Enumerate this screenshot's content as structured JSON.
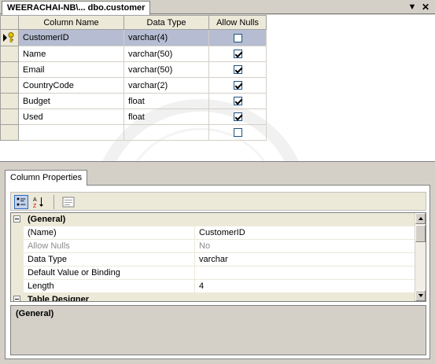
{
  "window": {
    "tab_title": "WEERACHAI-NB\\... dbo.customer",
    "dropdown_glyph": "▼",
    "close_glyph": "✕"
  },
  "table_designer": {
    "headers": {
      "name": "Column Name",
      "type": "Data Type",
      "nulls": "Allow Nulls"
    },
    "rows": [
      {
        "name": "CustomerID",
        "type": "varchar(4)",
        "allow_nulls": false,
        "primary_key": true,
        "selected": true
      },
      {
        "name": "Name",
        "type": "varchar(50)",
        "allow_nulls": true
      },
      {
        "name": "Email",
        "type": "varchar(50)",
        "allow_nulls": true
      },
      {
        "name": "CountryCode",
        "type": "varchar(2)",
        "allow_nulls": true
      },
      {
        "name": "Budget",
        "type": "float",
        "allow_nulls": true
      },
      {
        "name": "Used",
        "type": "float",
        "allow_nulls": true
      },
      {
        "name": "",
        "type": "",
        "allow_nulls": false
      }
    ]
  },
  "column_properties": {
    "tab_label": "Column Properties",
    "rows": [
      {
        "kind": "category",
        "name": "(General)"
      },
      {
        "kind": "prop",
        "name": "(Name)",
        "value": "CustomerID"
      },
      {
        "kind": "prop",
        "name": "Allow Nulls",
        "value": "No",
        "disabled": true
      },
      {
        "kind": "prop",
        "name": "Data Type",
        "value": "varchar"
      },
      {
        "kind": "prop",
        "name": "Default Value or Binding",
        "value": ""
      },
      {
        "kind": "prop",
        "name": "Length",
        "value": "4"
      },
      {
        "kind": "category",
        "name": "Table Designer"
      }
    ],
    "description_title": "(General)"
  },
  "colors": {
    "selection": "#b6bdd2",
    "chrome": "#d4d0c8",
    "header": "#ece9d8"
  }
}
